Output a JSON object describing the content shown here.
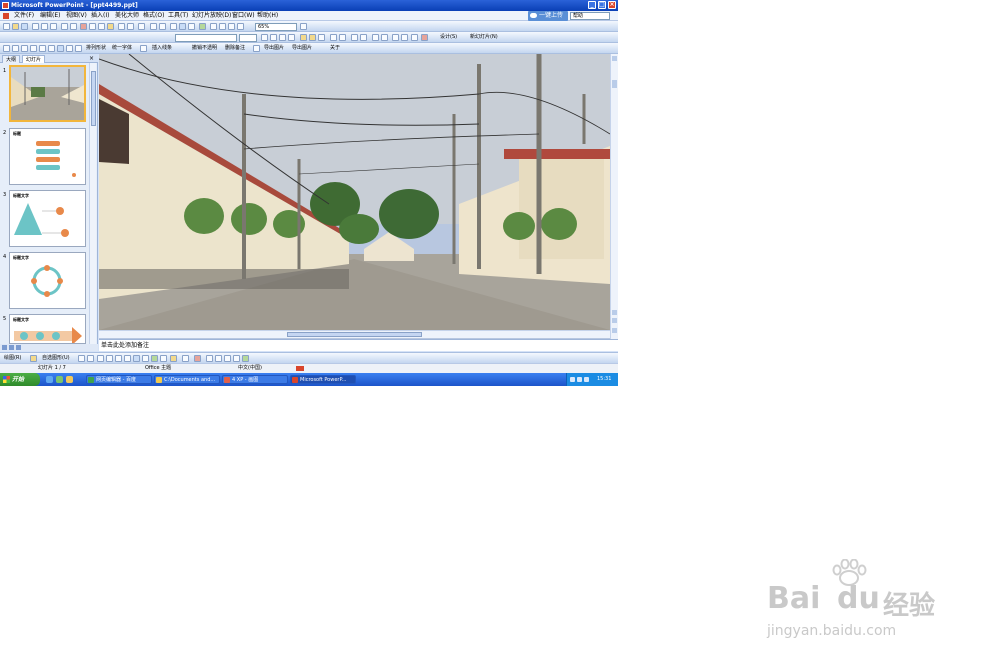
{
  "window": {
    "title": "Microsoft PowerPoint - [ppt4499.ppt]",
    "minimize_label": "_",
    "restore_label": "□",
    "close_label": "×"
  },
  "menubar": {
    "items": [
      "文件(F)",
      "编辑(E)",
      "视图(V)",
      "插入(I)",
      "美化大师",
      "格式(O)",
      "工具(T)",
      "幻灯片放映(D)",
      "窗口(W)",
      "帮助(H)"
    ],
    "upload_label": "一键上传",
    "help_box": "帮助"
  },
  "toolbar_standard": {
    "zoom": "65%"
  },
  "toolbar_format": {
    "font_size": "",
    "design_label": "设计(S)",
    "new_slide_label": "新幻灯片(N)"
  },
  "toolbar_beautify": {
    "items": [
      "排列形状",
      "统一字体",
      "插入线条",
      "撤销不透明",
      "删除备注",
      "导出图片",
      "导出图片",
      "关于"
    ]
  },
  "outline_pane": {
    "tabs": [
      "大纲",
      "幻灯片"
    ],
    "close_label": "×",
    "slides": [
      {
        "number": "1",
        "title": ""
      },
      {
        "number": "2",
        "title": "标题"
      },
      {
        "number": "3",
        "title": "标题文字"
      },
      {
        "number": "4",
        "title": "标题文字"
      },
      {
        "number": "5",
        "title": "标题文字"
      }
    ]
  },
  "notes": {
    "placeholder": "单击此处添加备注"
  },
  "drawing_toolbar": {
    "draw_label": "绘图(R)",
    "autoshape_label": "自选图形(U)"
  },
  "statusbar": {
    "slide_position": "幻灯片 1 / 7",
    "design_template": "Office 主题",
    "language": "中文(中国)"
  },
  "taskbar": {
    "start_label": "开始",
    "tasks": [
      {
        "label": "网页编辑器 - 百度",
        "icon": "browser-icon",
        "color": "#3fa34d"
      },
      {
        "label": "C:\\Documents and...",
        "icon": "folder-icon",
        "color": "#f2c94c"
      },
      {
        "label": "4 XP - 画图",
        "icon": "paint-icon",
        "color": "#e0604a"
      },
      {
        "label": "Microsoft PowerP...",
        "icon": "powerpoint-icon",
        "color": "#d9452b"
      }
    ],
    "clock": "15:31"
  },
  "watermark": {
    "brand": "Bai",
    "brand_suffix": "du",
    "jingyan": "经验",
    "url": "jingyan.baidu.com"
  },
  "colors": {
    "accent": "#0a3fb5",
    "taskbar": "#1c54c9",
    "start": "#2f8a2b",
    "slide_selected": "#f2b63c"
  }
}
